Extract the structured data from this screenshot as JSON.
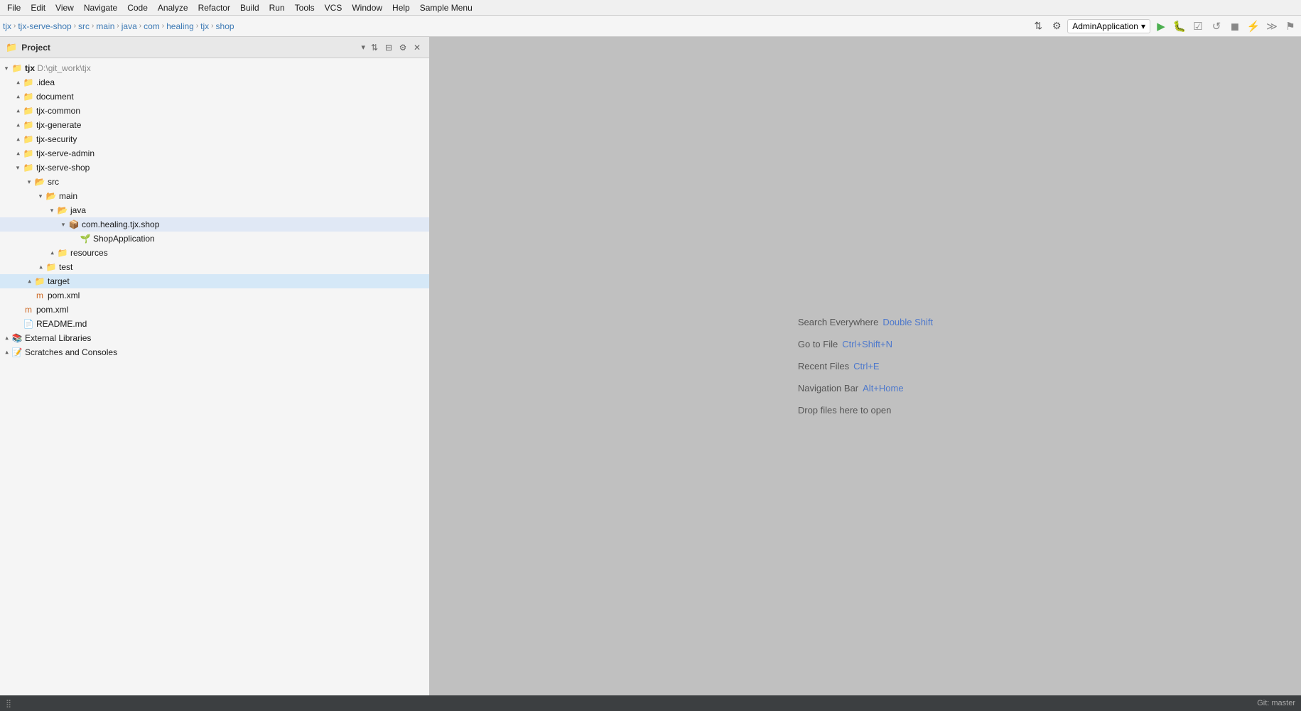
{
  "menubar": {
    "items": [
      "File",
      "Edit",
      "View",
      "Navigate",
      "Code",
      "Analyze",
      "Refactor",
      "Build",
      "Run",
      "Tools",
      "VCS",
      "Window",
      "Help",
      "Sample Menu"
    ]
  },
  "toolbar": {
    "breadcrumb": {
      "items": [
        "tjx",
        "tjx-serve-shop",
        "src",
        "main",
        "java",
        "com",
        "healing",
        "tjx",
        "shop"
      ]
    },
    "runConfig": "AdminApplication",
    "icons": {
      "sync": "⇅",
      "settings": "⚙",
      "run": "▶",
      "debug": "🐛",
      "coverage": "☑",
      "rerun": "↺",
      "stop": "◼",
      "more": "…"
    }
  },
  "project": {
    "title": "Project",
    "dropdown": "▾",
    "tree": [
      {
        "id": "tjx-root",
        "label": "tjx",
        "sublabel": "D:\\git_work\\tjx",
        "indent": 0,
        "type": "root",
        "open": true,
        "icon": "📁"
      },
      {
        "id": "idea",
        "label": ".idea",
        "indent": 1,
        "type": "folder",
        "open": false,
        "icon": "📁"
      },
      {
        "id": "document",
        "label": "document",
        "indent": 1,
        "type": "folder",
        "open": false,
        "icon": "📁"
      },
      {
        "id": "tjx-common",
        "label": "tjx-common",
        "indent": 1,
        "type": "module",
        "open": false,
        "icon": "📁"
      },
      {
        "id": "tjx-generate",
        "label": "tjx-generate",
        "indent": 1,
        "type": "module",
        "open": false,
        "icon": "📁"
      },
      {
        "id": "tjx-security",
        "label": "tjx-security",
        "indent": 1,
        "type": "module",
        "open": false,
        "icon": "📁"
      },
      {
        "id": "tjx-serve-admin",
        "label": "tjx-serve-admin",
        "indent": 1,
        "type": "module",
        "open": false,
        "icon": "📁"
      },
      {
        "id": "tjx-serve-shop",
        "label": "tjx-serve-shop",
        "indent": 1,
        "type": "module",
        "open": true,
        "icon": "📁"
      },
      {
        "id": "src",
        "label": "src",
        "indent": 2,
        "type": "folder-src",
        "open": true,
        "icon": "📂"
      },
      {
        "id": "main",
        "label": "main",
        "indent": 3,
        "type": "folder",
        "open": true,
        "icon": "📂"
      },
      {
        "id": "java",
        "label": "java",
        "indent": 4,
        "type": "folder-java",
        "open": true,
        "icon": "📂"
      },
      {
        "id": "com-healing-tjx-shop",
        "label": "com.healing.tjx.shop",
        "indent": 5,
        "type": "package",
        "open": true,
        "icon": "📦"
      },
      {
        "id": "ShopApplication",
        "label": "ShopApplication",
        "indent": 6,
        "type": "spring-class",
        "open": false,
        "icon": "🌱"
      },
      {
        "id": "resources",
        "label": "resources",
        "indent": 4,
        "type": "resources",
        "open": false,
        "icon": "📁"
      },
      {
        "id": "test",
        "label": "test",
        "indent": 3,
        "type": "folder",
        "open": false,
        "icon": "📁"
      },
      {
        "id": "target",
        "label": "target",
        "indent": 2,
        "type": "folder-target",
        "open": false,
        "icon": "📁",
        "selected": true
      },
      {
        "id": "pom-shop",
        "label": "pom.xml",
        "indent": 2,
        "type": "xml",
        "open": false,
        "icon": "📄"
      },
      {
        "id": "pom-root",
        "label": "pom.xml",
        "indent": 1,
        "type": "xml",
        "open": false,
        "icon": "📄"
      },
      {
        "id": "readme",
        "label": "README.md",
        "indent": 1,
        "type": "md",
        "open": false,
        "icon": "📄"
      },
      {
        "id": "external-libraries",
        "label": "External Libraries",
        "indent": 0,
        "type": "ext-lib",
        "open": false,
        "icon": "📚"
      },
      {
        "id": "scratches",
        "label": "Scratches and Consoles",
        "indent": 0,
        "type": "scratch",
        "open": false,
        "icon": "📝"
      }
    ]
  },
  "editor": {
    "hints": [
      {
        "label": "Search Everywhere",
        "key": "Double Shift"
      },
      {
        "label": "Go to File",
        "key": "Ctrl+Shift+N"
      },
      {
        "label": "Recent Files",
        "key": "Ctrl+E"
      },
      {
        "label": "Navigation Bar",
        "key": "Alt+Home"
      },
      {
        "label": "Drop files here to open",
        "key": ""
      }
    ]
  },
  "statusbar": {
    "left": "",
    "right": "Git: master"
  }
}
